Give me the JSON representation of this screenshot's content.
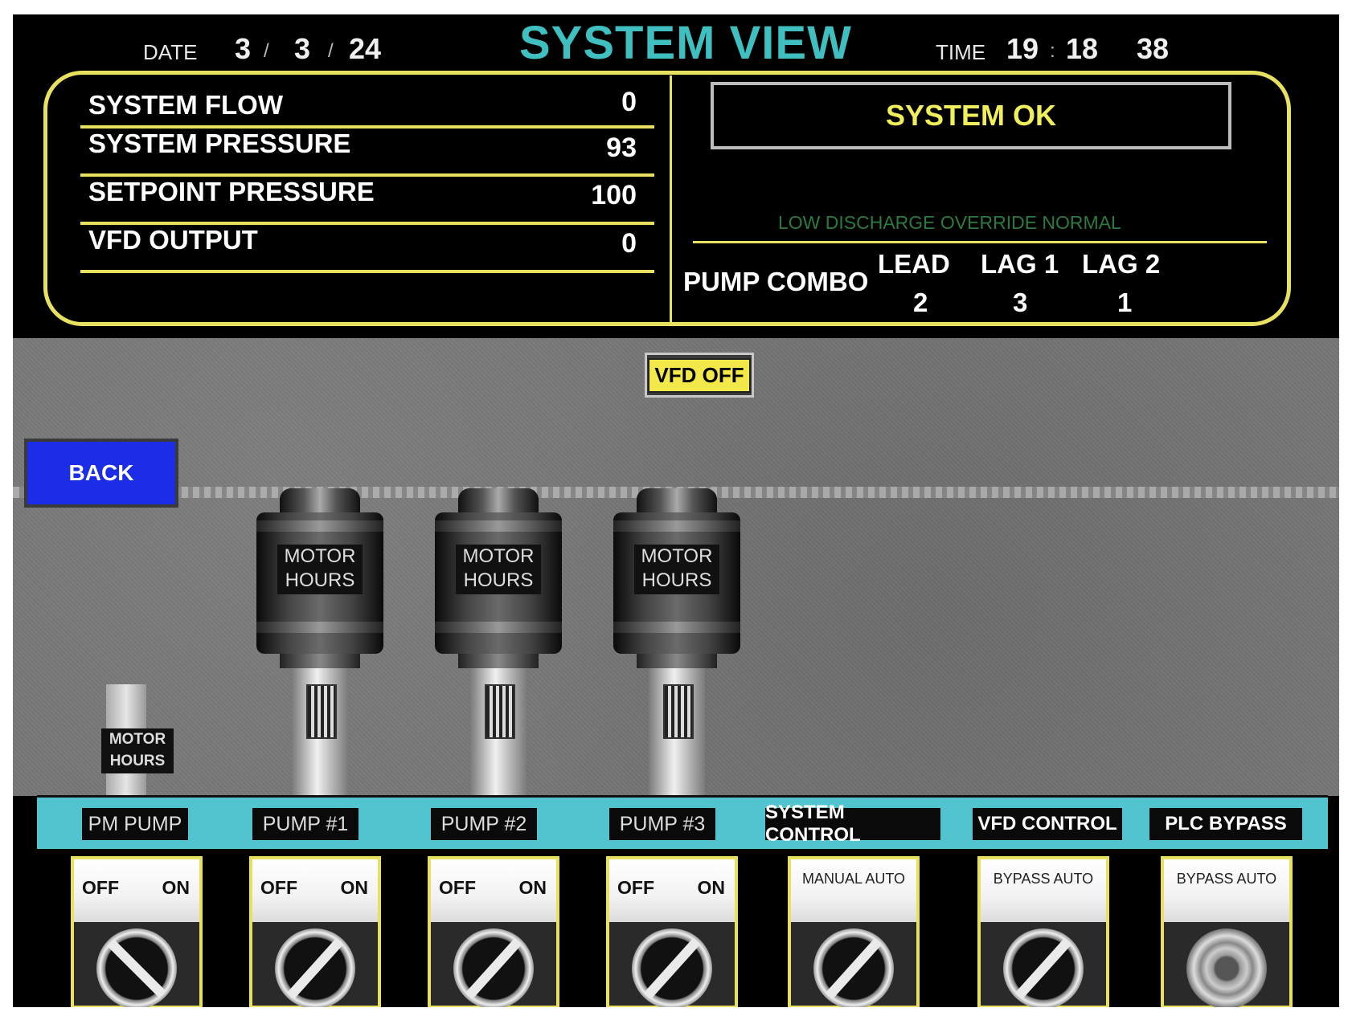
{
  "header": {
    "date_label": "DATE",
    "date": {
      "month": "3",
      "day": "3",
      "year": "24"
    },
    "title": "SYSTEM VIEW",
    "time_label": "TIME",
    "time": {
      "hours": "19",
      "minutes": "18",
      "seconds": "38"
    },
    "separators": {
      "date_sep": "/",
      "time_sep": ":"
    }
  },
  "measurements": [
    {
      "label": "SYSTEM  FLOW",
      "value": "0"
    },
    {
      "label": "SYSTEM PRESSURE",
      "value": "93"
    },
    {
      "label": "SETPOINT PRESSURE",
      "value": "100"
    },
    {
      "label": "VFD OUTPUT",
      "value": "0"
    }
  ],
  "status": {
    "text": "SYSTEM OK",
    "override": "LOW DISCHARGE OVERRIDE   NORMAL"
  },
  "pump_combo": {
    "label": "PUMP COMBO",
    "columns": [
      {
        "head": "LEAD",
        "value": "2"
      },
      {
        "head": "LAG 1",
        "value": "3"
      },
      {
        "head": "LAG 2",
        "value": "1"
      }
    ]
  },
  "vfd_status": "VFD OFF",
  "back_button": "BACK",
  "motors": [
    {
      "line1": "MOTOR",
      "line2": "HOURS"
    },
    {
      "line1": "MOTOR",
      "line2": "HOURS"
    },
    {
      "line1": "MOTOR",
      "line2": "HOURS"
    }
  ],
  "pm_motor": {
    "line1": "MOTOR",
    "line2": "HOURS"
  },
  "tags": [
    "PM PUMP",
    "PUMP #1",
    "PUMP #2",
    "PUMP #3",
    "SYSTEM CONTROL",
    "VFD  CONTROL",
    "PLC  BYPASS"
  ],
  "switches": [
    {
      "left": "OFF",
      "right": "ON",
      "state": "OFF"
    },
    {
      "left": "OFF",
      "right": "ON",
      "state": "ON"
    },
    {
      "left": "OFF",
      "right": "ON",
      "state": "ON"
    },
    {
      "left": "OFF",
      "right": "ON",
      "state": "ON"
    },
    {
      "labels": "MANUAL  AUTO",
      "state": "AUTO"
    },
    {
      "labels": "BYPASS  AUTO",
      "state": "AUTO"
    },
    {
      "labels": "BYPASS  AUTO",
      "state": "KEY"
    }
  ],
  "colors": {
    "accent_yellow": "#e8e060",
    "title_cyan": "#3fbfbf",
    "status_yellow": "#f0ee5a",
    "back_blue": "#1c2de8",
    "tag_bar_cyan": "#52c4cf",
    "override_green": "#2e7a3e"
  }
}
